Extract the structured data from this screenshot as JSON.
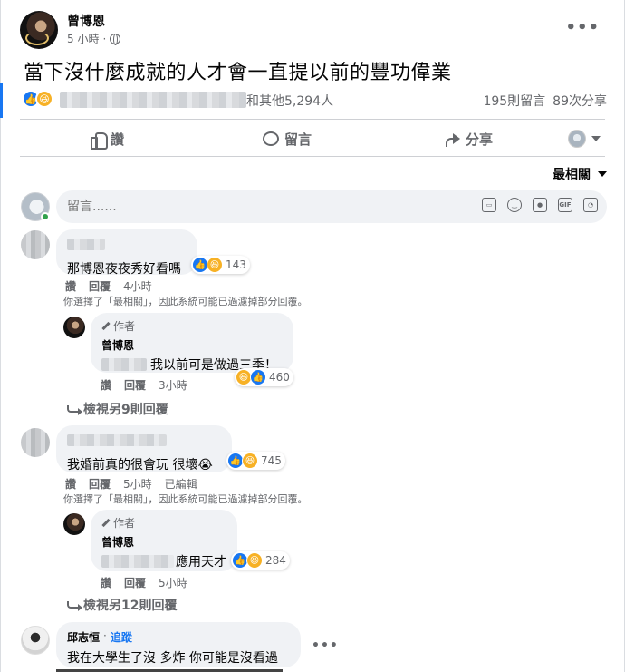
{
  "post": {
    "author": "曾博恩",
    "time": "5 小時",
    "text": "當下沒什麼成就的人才會一直提以前的豐功偉業",
    "reactions_text": "和其他5,294人",
    "comments_count": "195則留言",
    "shares_count": "89次分享"
  },
  "actions": {
    "like": "讚",
    "comment": "留言",
    "share": "分享"
  },
  "sort": {
    "label": "最相關"
  },
  "composer": {
    "placeholder": "留言......"
  },
  "composer_icons": [
    "emoji-sticker-icon",
    "smiley-icon",
    "camera-icon",
    "gif-icon",
    "sticker-icon"
  ],
  "comments": [
    {
      "text": "那博恩夜夜秀好看嗎",
      "reactions_count": "143",
      "like_label": "讚",
      "reply_label": "回覆",
      "time": "4小時",
      "note": "你選擇了「最相關」，因此系統可能已過濾掉部分回覆。",
      "reply": {
        "badge": "作者",
        "name": "曾博恩",
        "text": "我以前可是做過三季！",
        "reactions_count": "460",
        "like_label": "讚",
        "reply_label": "回覆",
        "time": "3小時"
      },
      "view_more": "檢視另9則回覆"
    },
    {
      "text": "我婚前真的很會玩 很壞😭",
      "reactions_count": "745",
      "like_label": "讚",
      "reply_label": "回覆",
      "time": "5小時",
      "edited": "已編輯",
      "note": "你選擇了「最相關」，因此系統可能已過濾掉部分回覆。",
      "reply": {
        "badge": "作者",
        "name": "曾博恩",
        "text": "應用天才",
        "reactions_count": "284",
        "like_label": "讚",
        "reply_label": "回覆",
        "time": "5小時"
      },
      "view_more": "檢視另12則回覆"
    },
    {
      "name": "邱志恒",
      "follow": "追蹤",
      "text": "我在大學生了沒 多炸 你可能是沒看過"
    }
  ],
  "colors": {
    "accent": "#1877f2",
    "secondary_text": "#65676b",
    "bubble": "#f0f2f5"
  }
}
